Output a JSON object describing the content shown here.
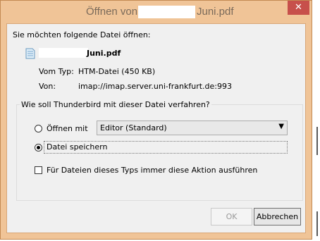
{
  "window": {
    "title_prefix": "Öffnen von",
    "title_suffix": "Juni.pdf",
    "close_label": "✕"
  },
  "prompt": "Sie möchten folgende Datei öffnen:",
  "file": {
    "name_suffix": "Juni.pdf",
    "type_label": "Vom Typ:",
    "type_value": "HTM-Datei (450 KB)",
    "from_label": "Von:",
    "from_value": "imap://imap.server.uni-frankfurt.de:993"
  },
  "action_group": {
    "heading": "Wie soll Thunderbird mit dieser Datei verfahren?",
    "open_with_label": "Öffnen mit",
    "open_with_selected": "Editor (Standard)",
    "save_label": "Datei speichern",
    "selected_option": "save",
    "remember_label": "Für Dateien dieses Typs immer diese Aktion ausführen",
    "remember_checked": false
  },
  "buttons": {
    "ok_label": "OK",
    "cancel_label": "Abbrechen"
  },
  "icons": {
    "close": "close-icon",
    "file": "document-icon",
    "dropdown": "chevron-down-icon"
  },
  "colors": {
    "title_bar": "#f0c497",
    "close_button": "#c7504b",
    "dialog_body": "#f0f0f0"
  }
}
